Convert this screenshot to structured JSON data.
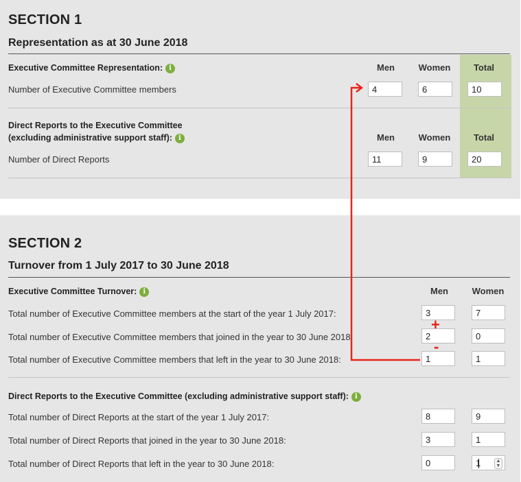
{
  "section1": {
    "heading": "SECTION 1",
    "subheading": "Representation as at 30 June 2018",
    "exec_rep": {
      "label": "Executive Committee Representation:",
      "col_men": "Men",
      "col_women": "Women",
      "col_total": "Total",
      "row_label": "Number of Executive Committee members",
      "men": "4",
      "women": "6",
      "total": "10"
    },
    "direct_rep": {
      "label_line1": "Direct Reports to the Executive Committee",
      "label_line2": "(excluding administrative support staff):",
      "col_men": "Men",
      "col_women": "Women",
      "col_total": "Total",
      "row_label": "Number of Direct Reports",
      "men": "11",
      "women": "9",
      "total": "20"
    }
  },
  "section2": {
    "heading": "SECTION 2",
    "subheading": "Turnover from 1 July 2017 to 30 June 2018",
    "exec_turnover": {
      "label": "Executive Committee Turnover:",
      "col_men": "Men",
      "col_women": "Women",
      "rows": [
        {
          "label": "Total number of Executive Committee members at the start of the year 1 July 2017:",
          "men": "3",
          "women": "7"
        },
        {
          "label": "Total number of Executive Committee members that joined in the year to 30 June 2018",
          "men": "2",
          "women": "0"
        },
        {
          "label": "Total number of Executive Committee members that left in the year to 30 June 2018:",
          "men": "1",
          "women": "1"
        }
      ]
    },
    "direct_turnover": {
      "label": "Direct Reports to the Executive Committee (excluding administrative support staff):",
      "rows": [
        {
          "label": "Total number of Direct Reports at the start of the year 1 July 2017:",
          "men": "8",
          "women": "9"
        },
        {
          "label": "Total number of Direct Reports that joined in the year to 30 June 2018:",
          "men": "3",
          "women": "1"
        },
        {
          "label": "Total number of Direct Reports that left in the year to 30 June 2018:",
          "men": "0",
          "women": "1"
        }
      ]
    }
  },
  "annotations": {
    "plus_sign": "+",
    "minus_sign": "-",
    "color": "#e8231a"
  },
  "info_icon_glyph": "i",
  "colors": {
    "panel_bg": "#e6e6e6",
    "total_column_bg": "#c7d6a9",
    "info_icon": "#7cae3c"
  }
}
